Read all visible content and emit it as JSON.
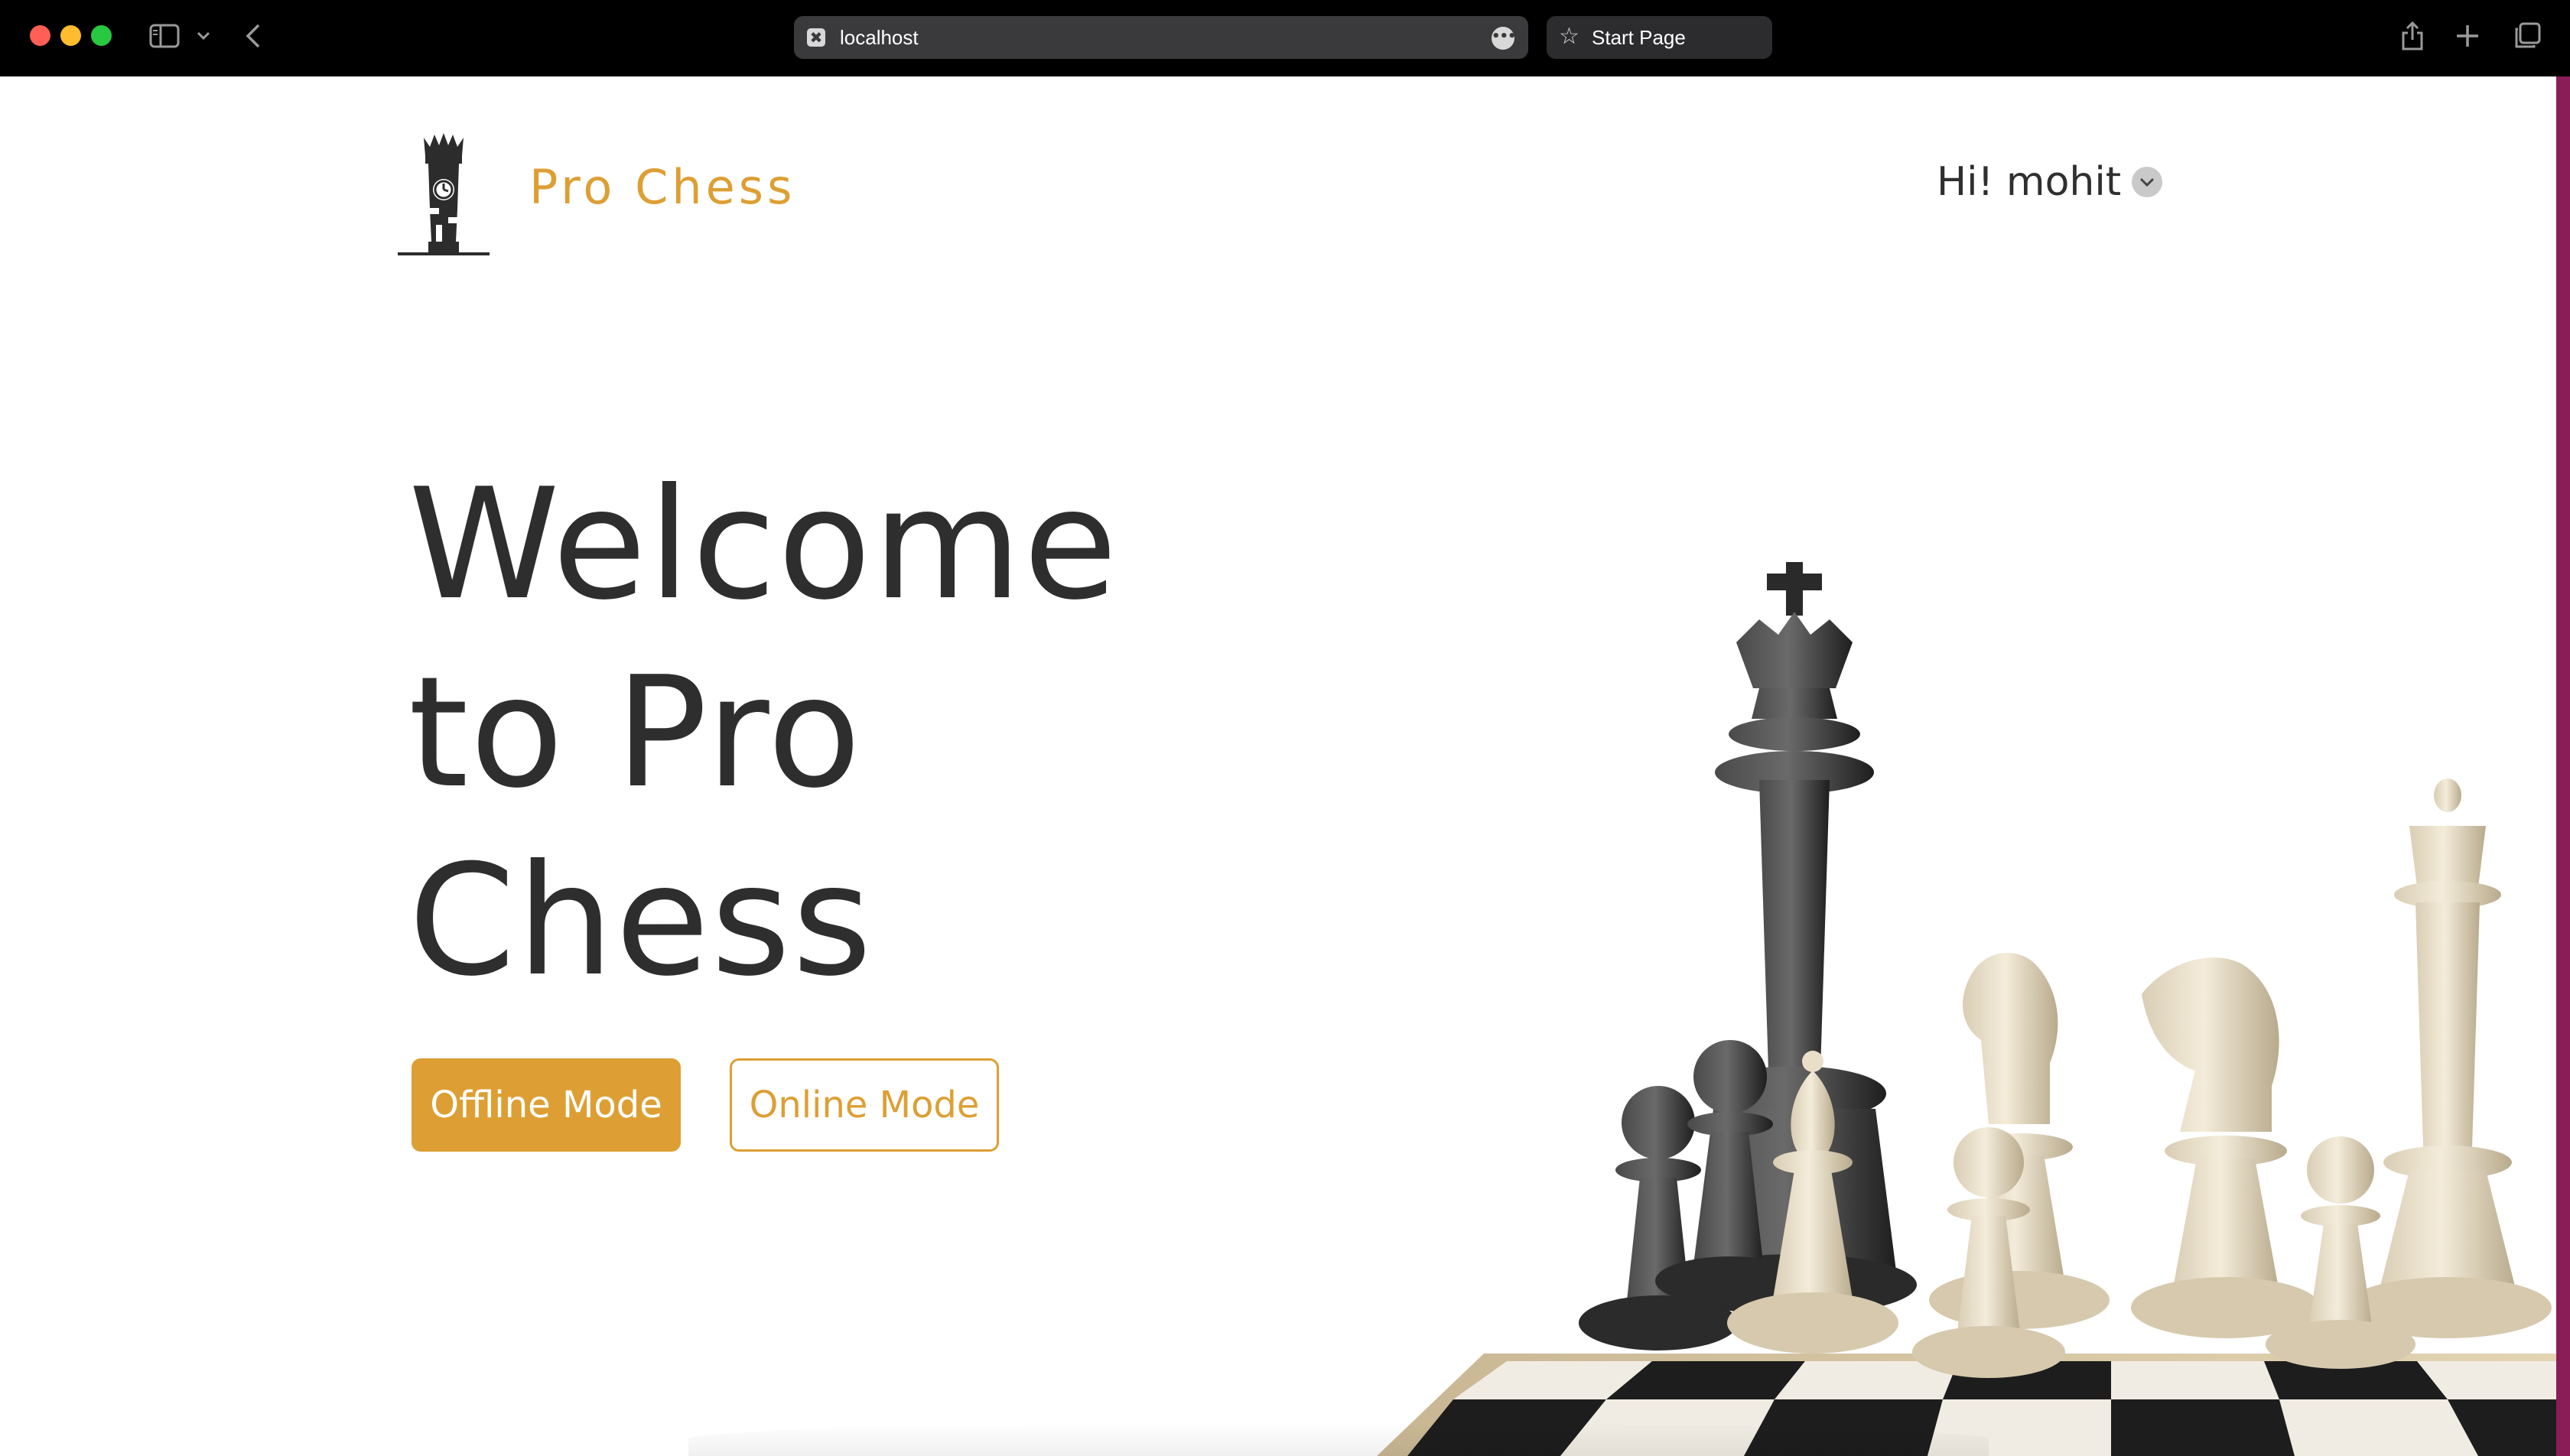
{
  "browser": {
    "url": "localhost",
    "favicon_glyph": "✖",
    "more_glyph": "•••",
    "start_tab_label": "Start Page",
    "star_glyph": "☆",
    "traffic_colors": {
      "close": "#ff5f57",
      "minimize": "#febc2e",
      "zoom": "#28c840"
    }
  },
  "header": {
    "brand": "Pro Chess",
    "greeting": "Hi! mohit"
  },
  "hero": {
    "title_lines": [
      "Welcome",
      "to Pro",
      "Chess"
    ],
    "offline_button": "Offline Mode",
    "online_button": "Online Mode"
  },
  "colors": {
    "accent": "#dd9f34",
    "text": "#2e2e2e",
    "scrollbar": "#8a1d57"
  },
  "icons": {
    "logo": "chess-rook-clock-icon",
    "user_caret": "chevron-down-icon",
    "hero": "chess-pieces-illustration"
  }
}
